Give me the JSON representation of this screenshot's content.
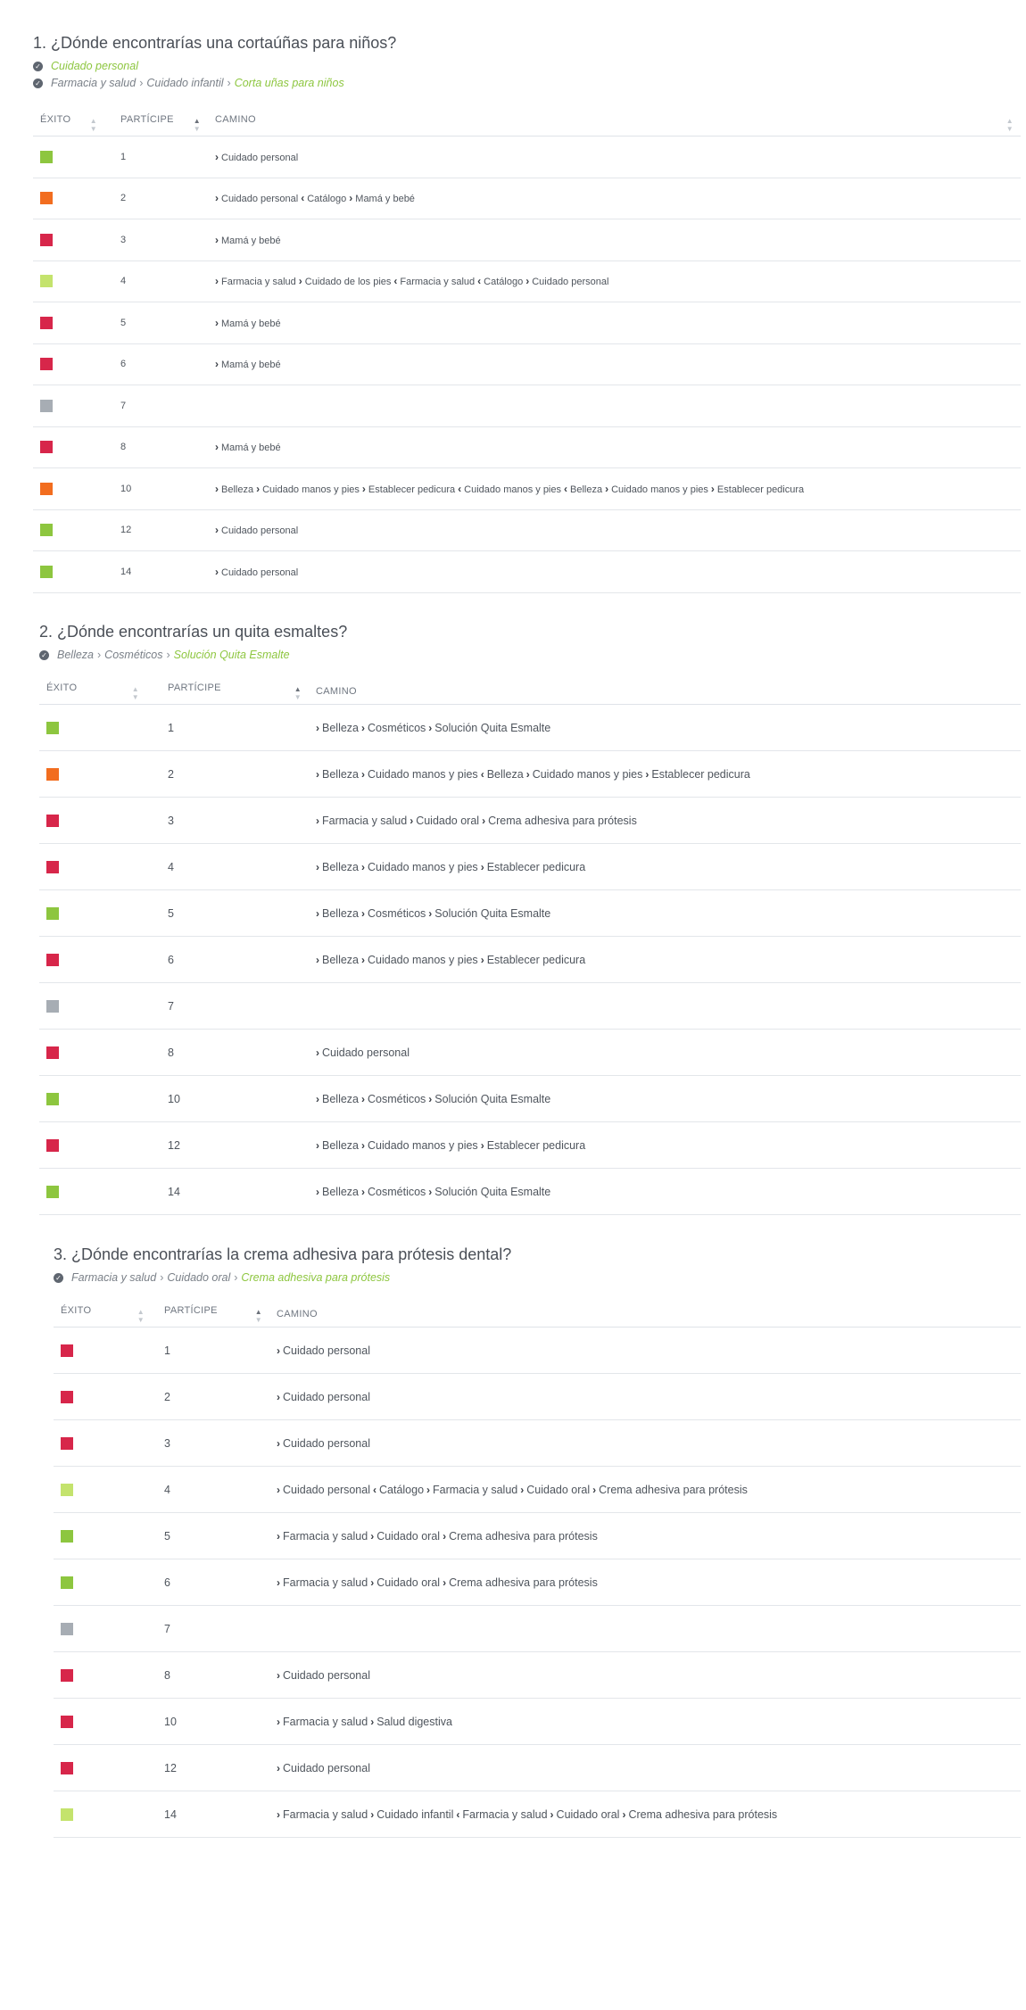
{
  "colors": {
    "success_direct": "#8dc63f",
    "success_indirect": "#c4e36d",
    "fail_direct": "#d7264a",
    "fail_indirect": "#f26d1f",
    "skip": "#a7adb4",
    "answer_green": "#8dc63f"
  },
  "table_headers": {
    "exito": "ÉXITO",
    "participe": "PARTÍCIPE",
    "camino": "CAMINO"
  },
  "questions": [
    {
      "title": "1. ¿Dónde encontrarías una cortaúñas para niños?",
      "answers": [
        {
          "parents": [],
          "final": "Cuidado personal"
        },
        {
          "parents": [
            "Farmacia y salud",
            "Cuidado infantil"
          ],
          "final": "Corta uñas para niños"
        }
      ],
      "rows": [
        {
          "status": "success_direct",
          "participant": "1",
          "path": [
            [
              "fwd",
              "Cuidado personal"
            ]
          ]
        },
        {
          "status": "fail_indirect",
          "participant": "2",
          "path": [
            [
              "fwd",
              "Cuidado personal"
            ],
            [
              "back",
              "Catálogo"
            ],
            [
              "fwd",
              "Mamá y bebé"
            ]
          ]
        },
        {
          "status": "fail_direct",
          "participant": "3",
          "path": [
            [
              "fwd",
              "Mamá y bebé"
            ]
          ]
        },
        {
          "status": "success_indirect",
          "participant": "4",
          "path": [
            [
              "fwd",
              "Farmacia y salud"
            ],
            [
              "fwd",
              "Cuidado de los pies"
            ],
            [
              "back",
              "Farmacia y salud"
            ],
            [
              "back",
              "Catálogo"
            ],
            [
              "fwd",
              "Cuidado personal"
            ]
          ]
        },
        {
          "status": "fail_direct",
          "participant": "5",
          "path": [
            [
              "fwd",
              "Mamá y bebé"
            ]
          ]
        },
        {
          "status": "fail_direct",
          "participant": "6",
          "path": [
            [
              "fwd",
              "Mamá y bebé"
            ]
          ]
        },
        {
          "status": "skip",
          "participant": "7",
          "path": []
        },
        {
          "status": "fail_direct",
          "participant": "8",
          "path": [
            [
              "fwd",
              "Mamá y bebé"
            ]
          ]
        },
        {
          "status": "fail_indirect",
          "participant": "10",
          "path": [
            [
              "fwd",
              "Belleza"
            ],
            [
              "fwd",
              "Cuidado manos y pies"
            ],
            [
              "fwd",
              "Establecer pedicura"
            ],
            [
              "back",
              "Cuidado manos y pies"
            ],
            [
              "back",
              "Belleza"
            ],
            [
              "fwd",
              "Cuidado manos y pies"
            ],
            [
              "fwd",
              "Establecer pedicura"
            ]
          ]
        },
        {
          "status": "success_direct",
          "participant": "12",
          "path": [
            [
              "fwd",
              "Cuidado personal"
            ]
          ]
        },
        {
          "status": "success_direct",
          "participant": "14",
          "path": [
            [
              "fwd",
              "Cuidado personal"
            ]
          ]
        }
      ]
    },
    {
      "title": "2. ¿Dónde encontrarías un quita esmaltes?",
      "answers": [
        {
          "parents": [
            "Belleza",
            "Cosméticos"
          ],
          "final": "Solución Quita Esmalte"
        }
      ],
      "rows": [
        {
          "status": "success_direct",
          "participant": "1",
          "path": [
            [
              "fwd",
              "Belleza"
            ],
            [
              "fwd",
              "Cosméticos"
            ],
            [
              "fwd",
              "Solución Quita Esmalte"
            ]
          ]
        },
        {
          "status": "fail_indirect",
          "participant": "2",
          "path": [
            [
              "fwd",
              "Belleza"
            ],
            [
              "fwd",
              "Cuidado manos y pies"
            ],
            [
              "back",
              "Belleza"
            ],
            [
              "fwd",
              "Cuidado manos y pies"
            ],
            [
              "fwd",
              "Establecer pedicura"
            ]
          ]
        },
        {
          "status": "fail_direct",
          "participant": "3",
          "path": [
            [
              "fwd",
              "Farmacia y salud"
            ],
            [
              "fwd",
              "Cuidado oral"
            ],
            [
              "fwd",
              "Crema adhesiva para prótesis"
            ]
          ]
        },
        {
          "status": "fail_direct",
          "participant": "4",
          "path": [
            [
              "fwd",
              "Belleza"
            ],
            [
              "fwd",
              "Cuidado manos y pies"
            ],
            [
              "fwd",
              "Establecer pedicura"
            ]
          ]
        },
        {
          "status": "success_direct",
          "participant": "5",
          "path": [
            [
              "fwd",
              "Belleza"
            ],
            [
              "fwd",
              "Cosméticos"
            ],
            [
              "fwd",
              "Solución Quita Esmalte"
            ]
          ]
        },
        {
          "status": "fail_direct",
          "participant": "6",
          "path": [
            [
              "fwd",
              "Belleza"
            ],
            [
              "fwd",
              "Cuidado manos y pies"
            ],
            [
              "fwd",
              "Establecer pedicura"
            ]
          ]
        },
        {
          "status": "skip",
          "participant": "7",
          "path": []
        },
        {
          "status": "fail_direct",
          "participant": "8",
          "path": [
            [
              "fwd",
              "Cuidado personal"
            ]
          ]
        },
        {
          "status": "success_direct",
          "participant": "10",
          "path": [
            [
              "fwd",
              "Belleza"
            ],
            [
              "fwd",
              "Cosméticos"
            ],
            [
              "fwd",
              "Solución Quita Esmalte"
            ]
          ]
        },
        {
          "status": "fail_direct",
          "participant": "12",
          "path": [
            [
              "fwd",
              "Belleza"
            ],
            [
              "fwd",
              "Cuidado manos y pies"
            ],
            [
              "fwd",
              "Establecer pedicura"
            ]
          ]
        },
        {
          "status": "success_direct",
          "participant": "14",
          "path": [
            [
              "fwd",
              "Belleza"
            ],
            [
              "fwd",
              "Cosméticos"
            ],
            [
              "fwd",
              "Solución Quita Esmalte"
            ]
          ]
        }
      ]
    },
    {
      "title": "3. ¿Dónde encontrarías la crema adhesiva para prótesis dental?",
      "answers": [
        {
          "parents": [
            "Farmacia y salud",
            "Cuidado oral"
          ],
          "final": "Crema adhesiva para prótesis"
        }
      ],
      "rows": [
        {
          "status": "fail_direct",
          "participant": "1",
          "path": [
            [
              "fwd",
              "Cuidado personal"
            ]
          ]
        },
        {
          "status": "fail_direct",
          "participant": "2",
          "path": [
            [
              "fwd",
              "Cuidado personal"
            ]
          ]
        },
        {
          "status": "fail_direct",
          "participant": "3",
          "path": [
            [
              "fwd",
              "Cuidado personal"
            ]
          ]
        },
        {
          "status": "success_indirect",
          "participant": "4",
          "path": [
            [
              "fwd",
              "Cuidado personal"
            ],
            [
              "back",
              "Catálogo"
            ],
            [
              "fwd",
              "Farmacia y salud"
            ],
            [
              "fwd",
              "Cuidado oral"
            ],
            [
              "fwd",
              "Crema adhesiva para prótesis"
            ]
          ]
        },
        {
          "status": "success_direct",
          "participant": "5",
          "path": [
            [
              "fwd",
              "Farmacia y salud"
            ],
            [
              "fwd",
              "Cuidado oral"
            ],
            [
              "fwd",
              "Crema adhesiva para prótesis"
            ]
          ]
        },
        {
          "status": "success_direct",
          "participant": "6",
          "path": [
            [
              "fwd",
              "Farmacia y salud"
            ],
            [
              "fwd",
              "Cuidado oral"
            ],
            [
              "fwd",
              "Crema adhesiva para prótesis"
            ]
          ]
        },
        {
          "status": "skip",
          "participant": "7",
          "path": []
        },
        {
          "status": "fail_direct",
          "participant": "8",
          "path": [
            [
              "fwd",
              "Cuidado personal"
            ]
          ]
        },
        {
          "status": "fail_direct",
          "participant": "10",
          "path": [
            [
              "fwd",
              "Farmacia y salud"
            ],
            [
              "fwd",
              "Salud digestiva"
            ]
          ]
        },
        {
          "status": "fail_direct",
          "participant": "12",
          "path": [
            [
              "fwd",
              "Cuidado personal"
            ]
          ]
        },
        {
          "status": "success_indirect",
          "participant": "14",
          "path": [
            [
              "fwd",
              "Farmacia y salud"
            ],
            [
              "fwd",
              "Cuidado infantil"
            ],
            [
              "back",
              "Farmacia y salud"
            ],
            [
              "fwd",
              "Cuidado oral"
            ],
            [
              "fwd",
              "Crema adhesiva para prótesis"
            ]
          ]
        }
      ]
    }
  ]
}
